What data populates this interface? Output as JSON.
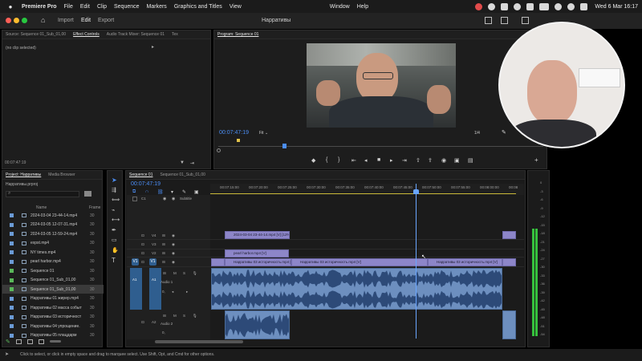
{
  "menubar": {
    "app": "Premiere Pro",
    "items": [
      "File",
      "Edit",
      "Clip",
      "Sequence",
      "Markers",
      "Graphics and Titles",
      "View",
      "Window",
      "Help"
    ],
    "clock": "Wed 6 Mar  16:17"
  },
  "titlebar": {
    "tabs": [
      "Import",
      "Edit",
      "Export"
    ],
    "project": "Нарративы"
  },
  "source_panel": {
    "tabs": [
      "Source: Sequence 01_Sub_01,00",
      "Effect Controls",
      "Audio Track Mixer: Sequence 01",
      "Tex"
    ],
    "empty": "(no clip selected)",
    "timecode": "00:07:47:19"
  },
  "program": {
    "title": "Program: Sequence 01",
    "timecode": "00:07:47:19",
    "fit": "Fit",
    "page": "1/4"
  },
  "project_panel": {
    "tabs": [
      "Project: Нарративы",
      "Media Browser"
    ],
    "file": "Нарративы.prproj",
    "col_name": "Name",
    "col_fr": "Frame",
    "items": [
      {
        "name": "2024-03-04 23-44-14.mp4",
        "fr": "30",
        "color": "#6b9bd6"
      },
      {
        "name": "2024-03-05 12-07-31.mp4",
        "fr": "30",
        "color": "#6b9bd6"
      },
      {
        "name": "2024-03-05 12-59-24.mp4",
        "fr": "30",
        "color": "#6b9bd6"
      },
      {
        "name": "expst.mp4",
        "fr": "30",
        "color": "#6b9bd6"
      },
      {
        "name": "NY times.mp4",
        "fr": "30",
        "color": "#6b9bd6"
      },
      {
        "name": "pearl harbor.mp4",
        "fr": "30",
        "color": "#6b9bd6"
      },
      {
        "name": "Sequence 01",
        "fr": "30",
        "color": "#5ab85a"
      },
      {
        "name": "Sequence 01_Sub_01,00",
        "fr": "30",
        "color": "#5ab85a"
      },
      {
        "name": "Sequence 01_Sub_01,00",
        "fr": "30",
        "color": "#5ab85a"
      },
      {
        "name": "Нарративы 01 жирер.mp4",
        "fr": "30",
        "color": "#6b9bd6"
      },
      {
        "name": "Нарративы 02 масса событ",
        "fr": "30",
        "color": "#6b9bd6"
      },
      {
        "name": "Нарративы 03 историчност",
        "fr": "30",
        "color": "#6b9bd6"
      },
      {
        "name": "Нарративы 04 упрощение.",
        "fr": "30",
        "color": "#6b9bd6"
      },
      {
        "name": "Нарративы 05 плацдарм",
        "fr": "30",
        "color": "#6b9bd6"
      }
    ]
  },
  "timeline": {
    "tabs": [
      "Sequence 01",
      "Sequence 01_Sub_01,00"
    ],
    "timecode": "00:07:47:19",
    "ruler": [
      "00:07:15:00",
      "00:07:20:00",
      "00:07:25:00",
      "00:07:30:00",
      "00:07:35:00",
      "00:07:40:00",
      "00:07:45:00",
      "00:07:50:00",
      "00:07:55:00",
      "00:08:00:00",
      "00:08"
    ],
    "subtitle_label": "Subtitle",
    "tracks_video": [
      "V4",
      "V3",
      "V2",
      "V1"
    ],
    "tracks_audio": [
      "A1",
      "A2"
    ],
    "source_patch": [
      "V1",
      "A1"
    ],
    "track_name_a1": "Audio 1",
    "track_name_a2": "Audio 2",
    "vol": "0,",
    "clips": {
      "v4": "2024-03-04 23-44-14.mp4 [V] [12%]",
      "v2": "pearl harbor.mp4 [V]",
      "v1a": "Нарративы 03 историчность.mp4 [V]",
      "v1b": "Нарративы 03 историчность.mp4 [V]",
      "v1c": "Нарративы 03 историчность.mp4 [V]"
    },
    "meter_labels": [
      "0",
      "-3",
      "-6",
      "-9",
      "-12",
      "-15",
      "-18",
      "-21",
      "-24",
      "-27",
      "-30",
      "-33",
      "-36",
      "-39",
      "-42",
      "-45",
      "-48",
      "-51",
      "-54"
    ]
  },
  "status": {
    "text": "Click to select, or click in empty space and drag to marquee select. Use Shift, Opt, and Cmd for other options."
  },
  "colors": {
    "accent": "#4b8ef5",
    "video_clip": "#8d86c9",
    "audio_clip": "#6d8fbf",
    "playhead": "#6aa6ff"
  }
}
